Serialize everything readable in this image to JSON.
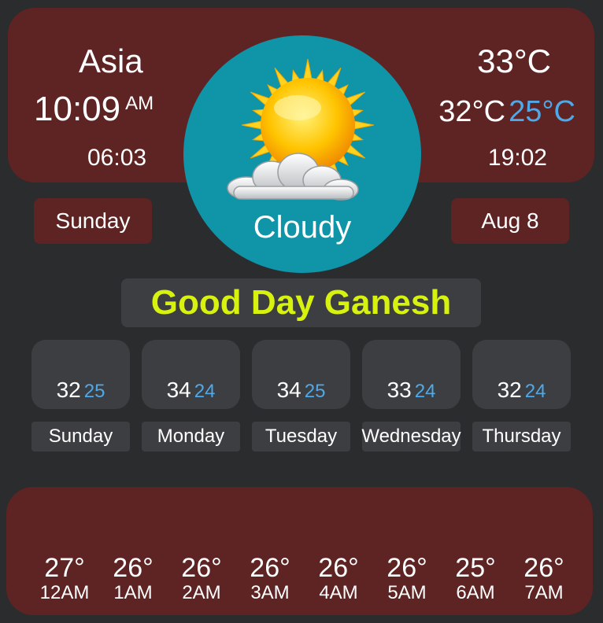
{
  "header": {
    "location": "Asia",
    "time": "10:09",
    "ampm": "AM",
    "sunrise": "06:03",
    "current_temp": "33°C",
    "high_temp": "32°C",
    "low_temp": "25°C",
    "sunset": "19:02"
  },
  "day_label": "Sunday",
  "date_label": "Aug 8",
  "condition": "Cloudy",
  "condition_icon": "sun-behind-cloud-icon",
  "greeting": "Good Day Ganesh",
  "forecast": [
    {
      "high": "32",
      "low": "25",
      "day": "Sunday"
    },
    {
      "high": "34",
      "low": "24",
      "day": "Monday"
    },
    {
      "high": "34",
      "low": "25",
      "day": "Tuesday"
    },
    {
      "high": "33",
      "low": "24",
      "day": "Wednesday"
    },
    {
      "high": "32",
      "low": "24",
      "day": "Thursday"
    }
  ],
  "hourly": [
    {
      "temp": "27°",
      "time": "12AM"
    },
    {
      "temp": "26°",
      "time": "1AM"
    },
    {
      "temp": "26°",
      "time": "2AM"
    },
    {
      "temp": "26°",
      "time": "3AM"
    },
    {
      "temp": "26°",
      "time": "4AM"
    },
    {
      "temp": "26°",
      "time": "5AM"
    },
    {
      "temp": "25°",
      "time": "6AM"
    },
    {
      "temp": "26°",
      "time": "7AM"
    }
  ],
  "colors": {
    "background": "#2b2c2e",
    "panel": "#5e2323",
    "circle": "#0f94a8",
    "card": "#3d3e41",
    "greeting_text": "#d7f20e",
    "low_temp": "#4fa9e8"
  }
}
